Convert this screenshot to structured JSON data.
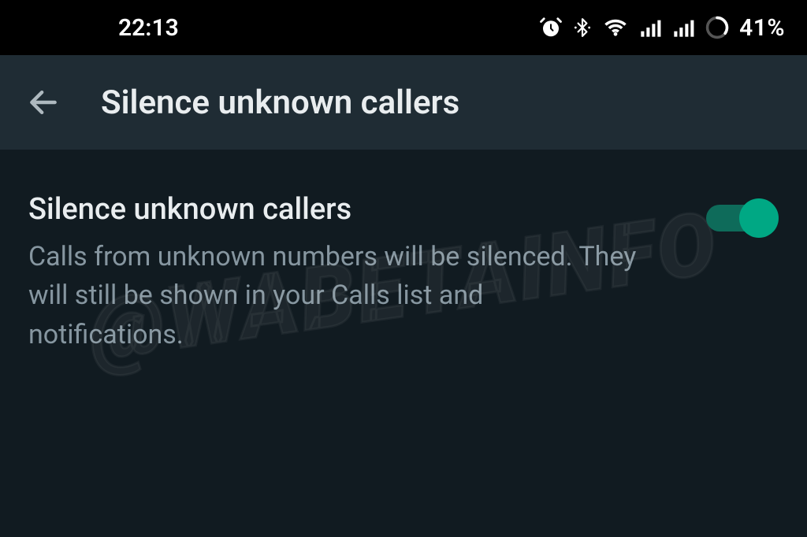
{
  "status": {
    "time": "22:13",
    "battery_text": "41%"
  },
  "appbar": {
    "title": "Silence unknown callers"
  },
  "setting": {
    "title": "Silence unknown callers",
    "description": "Calls from unknown numbers will be silenced. They will still be shown in your Calls list and notifications.",
    "enabled": true
  },
  "watermark": "@WABETAINFO"
}
